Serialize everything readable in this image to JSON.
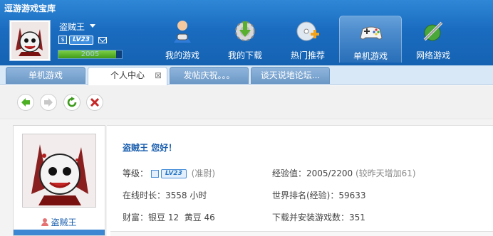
{
  "app": {
    "title": "逗游游戏宝库"
  },
  "user": {
    "name": "盗贼王",
    "level_badge": "LV23",
    "vip_mark": "$",
    "xp_value": "2005",
    "xp_progress": 0.91
  },
  "nav": [
    {
      "label": "我的游戏",
      "icon": "person-controller-icon"
    },
    {
      "label": "我的下载",
      "icon": "download-gear-icon"
    },
    {
      "label": "热门推荐",
      "icon": "disc-plus-icon"
    },
    {
      "label": "单机游戏",
      "icon": "gamepad-icon",
      "active": true
    },
    {
      "label": "网络游戏",
      "icon": "sword-globe-icon"
    }
  ],
  "tabs": [
    {
      "label": "单机游戏"
    },
    {
      "label": "个人中心",
      "active": true,
      "close": "⊠"
    },
    {
      "label": "发帖庆祝。。。"
    },
    {
      "label": "谈天说地论坛..."
    }
  ],
  "toolbar": [
    {
      "name": "back-button",
      "icon": "arrow-left-icon"
    },
    {
      "name": "forward-button",
      "icon": "arrow-right-icon"
    },
    {
      "name": "refresh-button",
      "icon": "refresh-icon"
    },
    {
      "name": "stop-button",
      "icon": "close-icon"
    }
  ],
  "profile": {
    "sidebar_name": "盗贼王",
    "greeting": "盗贼王 您好！",
    "level_label": "等级：",
    "level_badge": "LV23",
    "level_title": "(准尉)",
    "online_label": "在线时长：",
    "online_value": "3558 小时",
    "wealth_label": "财富：",
    "wealth_value": "银豆 12  黄豆 46",
    "exp_label": "经验值：",
    "exp_value": "2005/2200",
    "exp_note": "(较昨天增加61)",
    "rank_label": "世界排名(经验)：",
    "rank_value": "59633",
    "downloads_label": "下载并安装游戏数：",
    "downloads_value": "351"
  },
  "colors": {
    "header": "#1a6cc0",
    "link": "#1b5fae",
    "accent_green": "#3f9b16",
    "stop_red": "#c62828"
  }
}
